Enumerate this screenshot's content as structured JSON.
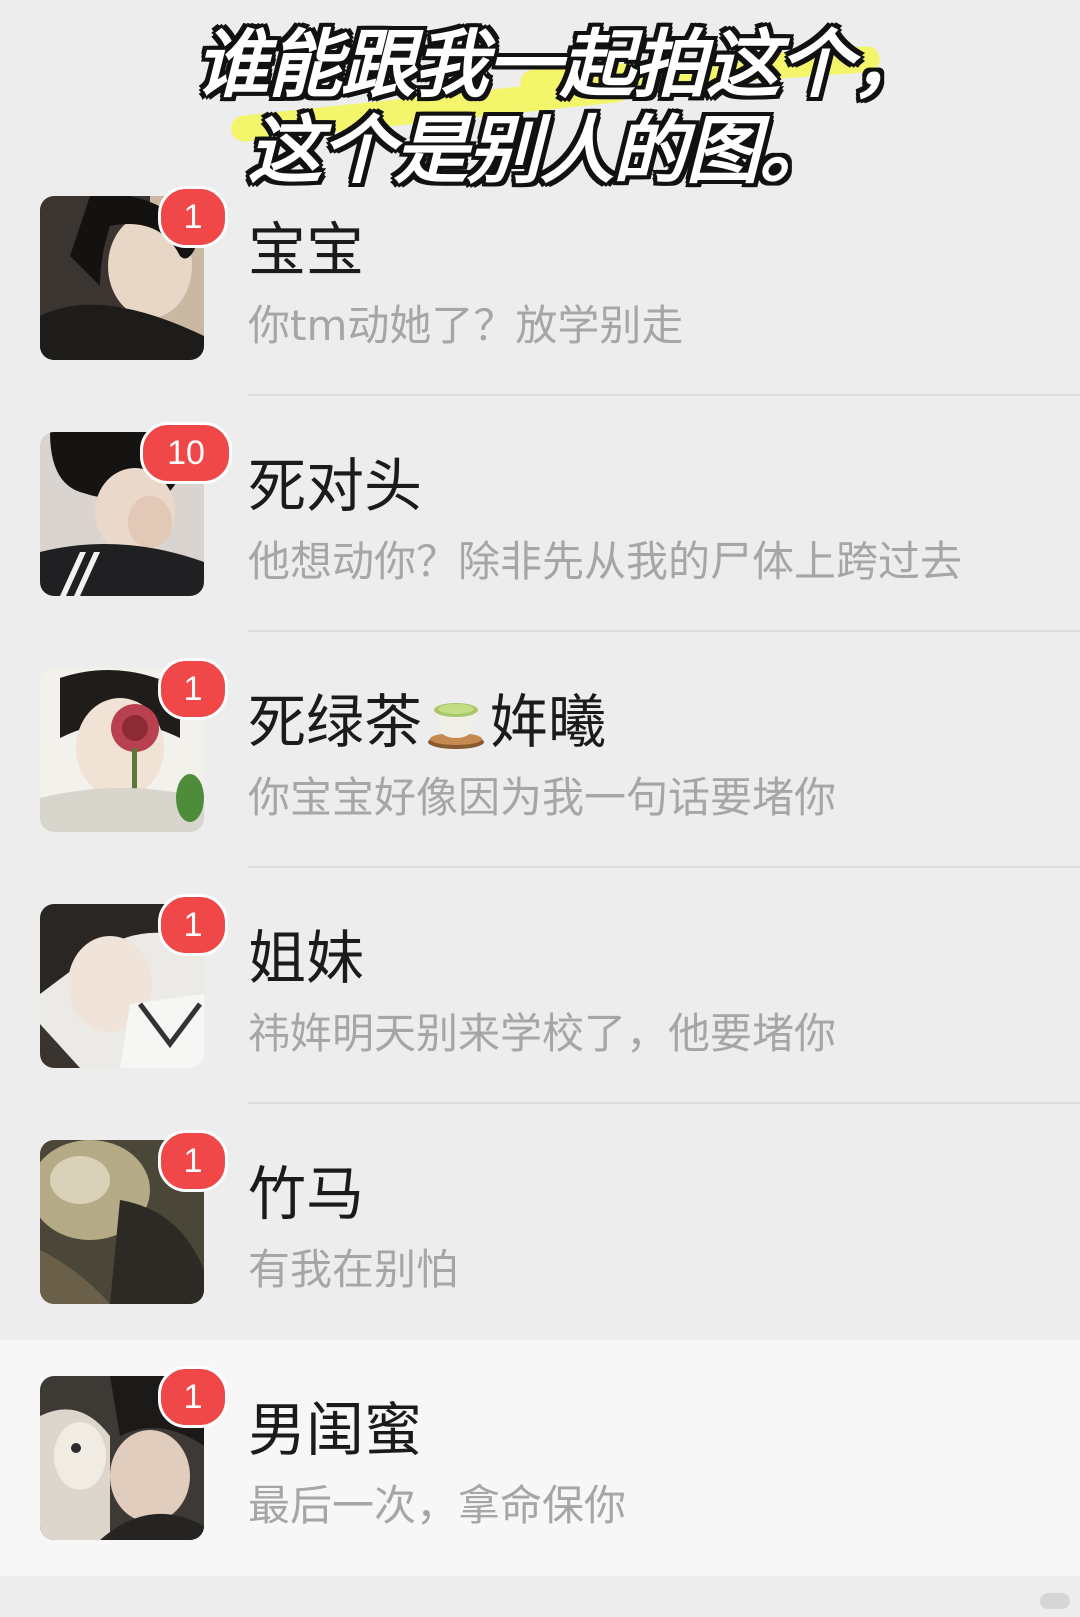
{
  "caption": {
    "line1": "谁能跟我一起拍这个，",
    "line2": "这个是别人的图。"
  },
  "chats": [
    {
      "name": "宝宝",
      "name_suffix": "",
      "preview": "你tm动她了？放学别走",
      "badge": "1",
      "avatar_icon": "avatar-photo-boy-dark-jacket"
    },
    {
      "name": "死对头",
      "name_suffix": "",
      "preview": "他想动你？除非先从我的尸体上跨过去",
      "badge": "10",
      "avatar_icon": "avatar-photo-boy-hand-face"
    },
    {
      "name": "死绿茶",
      "name_suffix": "姩曦",
      "preview": "你宝宝好像因为我一句话要堵你",
      "badge": "1",
      "avatar_icon": "avatar-photo-girl-flower",
      "emoji": "green-tea-cup-icon"
    },
    {
      "name": "姐妹",
      "name_suffix": "",
      "preview": "祎姩明天别来学校了，他要堵你",
      "badge": "1",
      "avatar_icon": "avatar-photo-girl-lying"
    },
    {
      "name": "竹马",
      "name_suffix": "",
      "preview": "有我在别怕",
      "badge": "1",
      "avatar_icon": "avatar-photo-dim-scene"
    },
    {
      "name": "男闺蜜",
      "name_suffix": "",
      "preview": "最后一次，拿命保你",
      "badge": "1",
      "avatar_icon": "avatar-photo-boy-cat"
    }
  ],
  "colors": {
    "background": "#ededed",
    "active_row": "#f7f7f7",
    "badge": "#f04848",
    "name_text": "#1b1b1b",
    "preview_text": "#a6a6a6",
    "caption_highlight": "#f3f66a"
  }
}
